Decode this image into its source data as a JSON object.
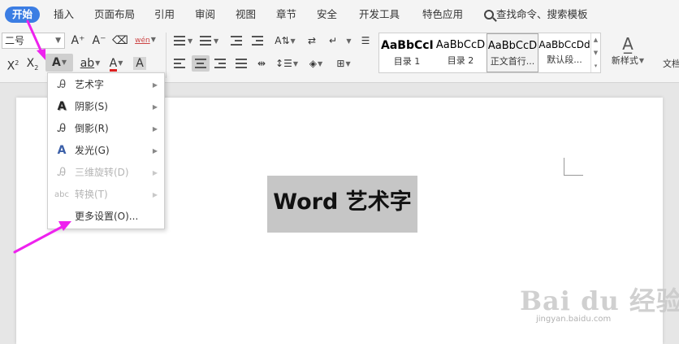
{
  "menu": {
    "tabs": [
      {
        "label": "开始"
      },
      {
        "label": "插入"
      },
      {
        "label": "页面布局"
      },
      {
        "label": "引用"
      },
      {
        "label": "审阅"
      },
      {
        "label": "视图"
      },
      {
        "label": "章节"
      },
      {
        "label": "安全"
      },
      {
        "label": "开发工具"
      },
      {
        "label": "特色应用"
      }
    ],
    "search_label": "查找命令、搜索模板"
  },
  "toolbar": {
    "font_size_value": "二号",
    "font_grow": "A⁺",
    "font_shrink": "A⁻",
    "superscript_label": "X",
    "subscript_label": "X",
    "phonetic_label": "wén",
    "text_effect_glyph": "A",
    "highlight_glyph": "ab",
    "font_color_glyph": "A",
    "char_shade_glyph": "A",
    "styles": [
      {
        "sample": "AaBbCcI",
        "name": "目录 1"
      },
      {
        "sample": "AaBbCcD",
        "name": "目录 2"
      },
      {
        "sample": "AaBbCcD",
        "name": "正文首行..."
      },
      {
        "sample": "AaBbCcDd",
        "name": "默认段..."
      }
    ],
    "new_style_label": "新样式",
    "doc_assistant_label": "文档"
  },
  "document": {
    "art_text": "Word 艺术字"
  },
  "dropdown": {
    "items": [
      {
        "label": "艺术字",
        "has_submenu": true,
        "disabled": false,
        "icon": "art-text-icon"
      },
      {
        "label": "阴影(S)",
        "has_submenu": true,
        "disabled": false,
        "icon": "shadow-icon"
      },
      {
        "label": "倒影(R)",
        "has_submenu": true,
        "disabled": false,
        "icon": "reflection-icon"
      },
      {
        "label": "发光(G)",
        "has_submenu": true,
        "disabled": false,
        "icon": "glow-icon"
      },
      {
        "label": "三维旋转(D)",
        "has_submenu": true,
        "disabled": true,
        "icon": "3d-rotation-icon"
      },
      {
        "label": "转换(T)",
        "has_submenu": true,
        "disabled": true,
        "icon": "transform-icon"
      },
      {
        "label": "更多设置(O)...",
        "has_submenu": false,
        "disabled": false,
        "icon": ""
      }
    ]
  },
  "colors": {
    "active_tab": "#3b7de3",
    "annotation_arrow": "#ee22ee",
    "glow_icon": "#3b5fa8",
    "font_color_underline": "#e02020"
  },
  "watermark": {
    "brand": "Bai du 经验",
    "url": "jingyan.baidu.com"
  }
}
